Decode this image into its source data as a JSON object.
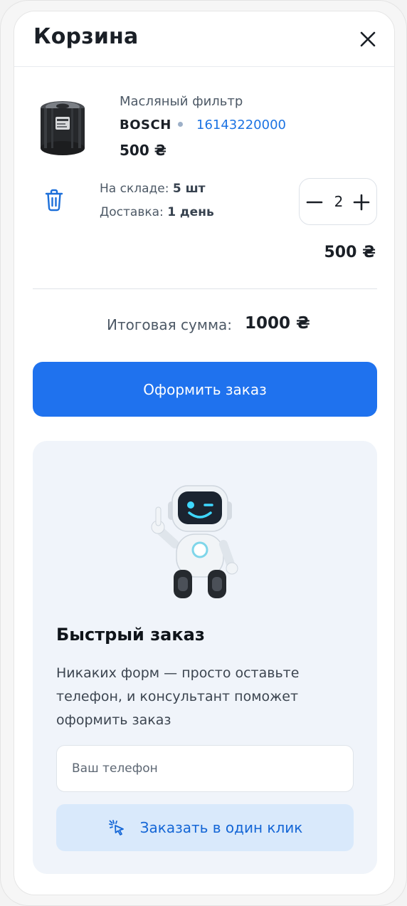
{
  "header": {
    "title": "Корзина",
    "close_icon": "close-icon"
  },
  "cart_item": {
    "name": "Масляный фильтр",
    "brand": "BOSCH",
    "code": "16143220000",
    "price": "500 ₴",
    "stock_label": "На складе:",
    "stock_value": "5 шт",
    "delivery_label": "Доставка:",
    "delivery_value": "1 день",
    "quantity": "2",
    "line_total": "500 ₴",
    "delete_icon": "trash-icon",
    "minus_icon": "minus-icon",
    "plus_icon": "plus-icon"
  },
  "summary": {
    "label": "Итоговая сумма:",
    "value": "1000 ₴"
  },
  "checkout_button": "Оформить заказ",
  "quick_order": {
    "title": "Быстрый заказ",
    "description": "Никаких форм — просто оставьте телефон, и консультант поможет оформить заказ",
    "phone_placeholder": "Ваш телефон",
    "button_label": "Заказать в один клик",
    "button_icon": "pointer-click-icon"
  },
  "colors": {
    "accent": "#1f72ee",
    "link": "#1c73e3",
    "quick_bg": "#f0f4fa",
    "one_click_bg": "#d9e9fb"
  }
}
